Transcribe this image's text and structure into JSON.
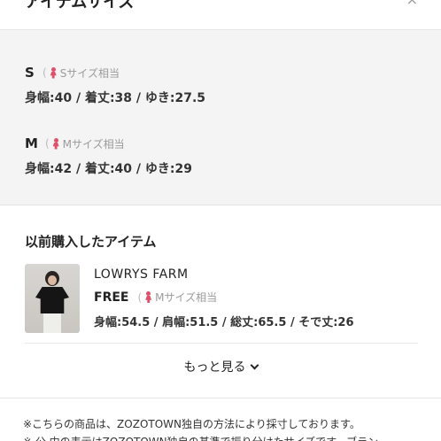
{
  "header": {
    "title": "アイテムサイズ",
    "close_icon": "×"
  },
  "sizes": [
    {
      "letter": "S",
      "tag": "Sサイズ相当",
      "paren": "(",
      "measurements": "身幅:40 / 着丈:38 / ゆき:27.5"
    },
    {
      "letter": "M",
      "tag": "Mサイズ相当",
      "paren": "(",
      "measurements": "身幅:42 / 着丈:40 / ゆき:29"
    }
  ],
  "previous": {
    "title": "以前購入したアイテム",
    "item": {
      "brand": "LOWRYS FARM",
      "size_label": "FREE",
      "paren": "(",
      "tag": "Mサイズ相当",
      "measurements": "身幅:54.5 / 肩幅:51.5 / 総丈:65.5 / そで丈:26"
    },
    "more_label": "もっと見る"
  },
  "notes": [
    "※こちらの商品は、ZOZOTOWN独自の方法により採寸しております。",
    "※ 公 内の表示はZOZOTOWN独自の基準で振り分けたサイズです。ブラン"
  ],
  "colors": {
    "accent_person": "#e0506a",
    "section_bg": "#f4f4f4"
  },
  "icons": [
    "person-icon",
    "chevron-down-icon",
    "close-icon"
  ]
}
